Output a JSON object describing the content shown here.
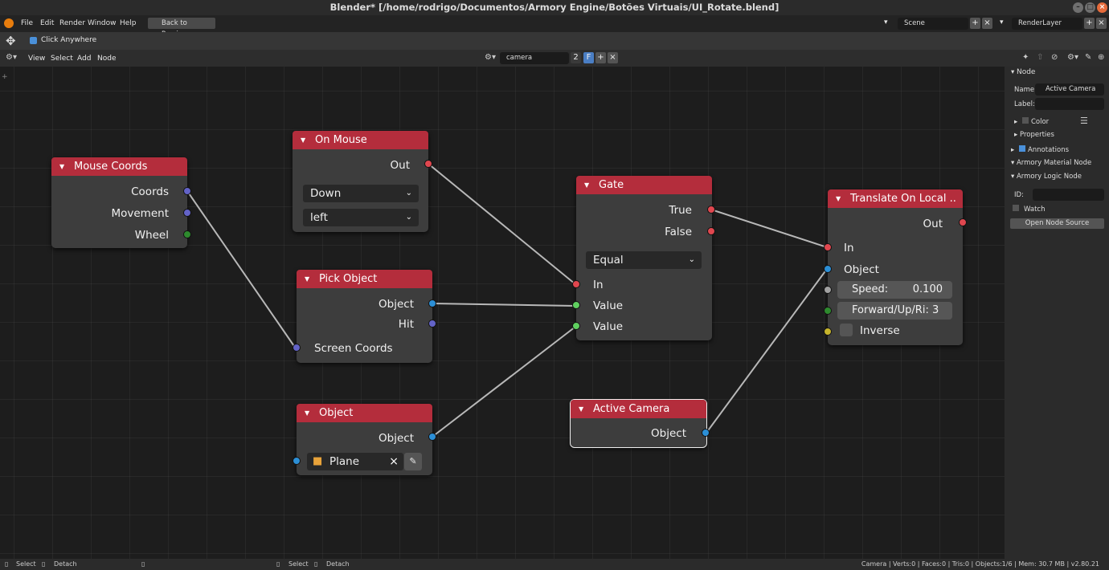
{
  "window": {
    "title": "Blender* [/home/rodrigo/Documentos/Armory Engine/Botões Virtuais/UI_Rotate.blend]"
  },
  "menu": {
    "file": "File",
    "edit": "Edit",
    "render": "Render",
    "window": "Window",
    "help": "Help",
    "back": "Back to Previous"
  },
  "scene": {
    "name": "Scene",
    "layer": "RenderLayer"
  },
  "toolbar": {
    "click_anywhere": "Click Anywhere"
  },
  "editor_header": {
    "view": "View",
    "select": "Select",
    "add": "Add",
    "node": "Node",
    "tree_name": "camera",
    "users": "2",
    "fake": "F"
  },
  "nodes": {
    "mouse_coords": {
      "title": "Mouse Coords",
      "out1": "Coords",
      "out2": "Movement",
      "out3": "Wheel"
    },
    "on_mouse": {
      "title": "On Mouse",
      "out": "Out",
      "event": "Down",
      "button": "left"
    },
    "pick_object": {
      "title": "Pick Object",
      "out1": "Object",
      "out2": "Hit",
      "in1": "Screen Coords"
    },
    "object": {
      "title": "Object",
      "out": "Object",
      "value": "Plane"
    },
    "gate": {
      "title": "Gate",
      "out1": "True",
      "out2": "False",
      "op": "Equal",
      "in1": "In",
      "in2": "Value",
      "in3": "Value"
    },
    "active_camera": {
      "title": "Active Camera",
      "out": "Object"
    },
    "translate": {
      "title": "Translate On Local ..",
      "out": "Out",
      "in1": "In",
      "in2": "Object",
      "speed_label": "Speed:",
      "speed": "0.100",
      "axis_label": "Forward/Up/Ri:",
      "axis": "3",
      "inverse": "Inverse"
    }
  },
  "panel": {
    "section": "Node",
    "name_label": "Name:",
    "name_value": "Active Camera",
    "label_label": "Label:",
    "color": "Color",
    "properties": "Properties",
    "annotations": "Annotations",
    "material": "Armory Material Node",
    "logic": "Armory Logic Node",
    "id_label": "ID:",
    "watch": "Watch",
    "open_source": "Open Node Source"
  },
  "status": {
    "select": "Select",
    "detach": "Detach",
    "select2": "Select",
    "detach2": "Detach",
    "stats": "Camera | Verts:0 | Faces:0 | Tris:0 | Objects:1/6 | Mem: 30.7 MB | v2.80.21"
  },
  "colors": {
    "node_header": "#b42d3c",
    "exec_socket": "#e0474f",
    "object_socket": "#2c8fd6",
    "vector_socket": "#6363c7",
    "value_socket": "#a1a1a1",
    "int_socket": "#2e8a2e",
    "bool_socket": "#c7b52c",
    "green_socket": "#5fcf5f"
  },
  "icons": [
    "blender-logo-icon",
    "move-tool-icon",
    "node-editor-icon",
    "close-icon",
    "eyedropper-icon",
    "cube-icon"
  ]
}
